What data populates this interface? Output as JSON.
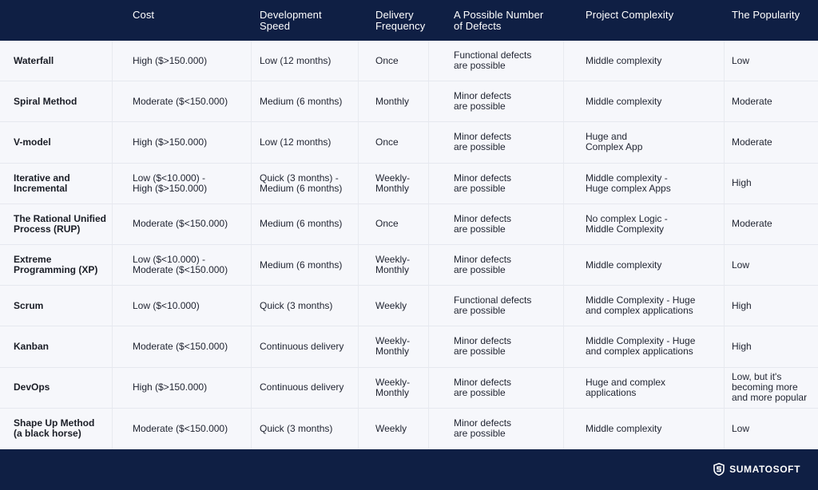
{
  "table": {
    "headers": [
      "",
      "Cost",
      "Development\nSpeed",
      "Delivery\nFrequency",
      "A Possible Number\nof Defects",
      "Project Complexity",
      "The Popularity"
    ],
    "rows": [
      [
        "Waterfall",
        "High ($>150.000)",
        "Low (12 months)",
        "Once",
        "Functional defects\nare possible",
        "Middle complexity",
        "Low"
      ],
      [
        "Spiral Method",
        "Moderate ($<150.000)",
        "Medium (6 months)",
        "Monthly",
        "Minor defects\nare possible",
        "Middle complexity",
        "Moderate"
      ],
      [
        "V-model",
        "High ($>150.000)",
        "Low (12 months)",
        "Once",
        "Minor defects\nare possible",
        "Huge and\nComplex App",
        "Moderate"
      ],
      [
        "Iterative and\nIncremental",
        "Low ($<10.000) -\nHigh ($>150.000)",
        "Quick (3 months) -\nMedium (6 months)",
        "Weekly-\nMonthly",
        "Minor defects\nare possible",
        "Middle complexity -\nHuge complex Apps",
        "High"
      ],
      [
        "The Rational Unified\nProcess (RUP)",
        "Moderate ($<150.000)",
        "Medium (6 months)",
        "Once",
        "Minor defects\nare possible",
        "No complex Logic -\nMiddle Complexity",
        "Moderate"
      ],
      [
        "Extreme\nProgramming (XP)",
        "Low ($<10.000) -\nModerate ($<150.000)",
        "Medium (6 months)",
        "Weekly-\nMonthly",
        "Minor defects\nare possible",
        "Middle complexity",
        "Low"
      ],
      [
        "Scrum",
        "Low ($<10.000)",
        "Quick (3 months)",
        "Weekly",
        "Functional defects\nare possible",
        "Middle Complexity - Huge\nand complex applications",
        "High"
      ],
      [
        "Kanban",
        "Moderate ($<150.000)",
        "Continuous delivery",
        "Weekly-\nMonthly",
        "Minor defects\nare possible",
        "Middle Complexity - Huge\nand complex applications",
        "High"
      ],
      [
        "DevOps",
        "High ($>150.000)",
        "Continuous delivery",
        "Weekly-\nMonthly",
        "Minor defects\nare possible",
        "Huge and complex\napplications",
        "Low, but it's\nbecoming more\nand more popular"
      ],
      [
        "Shape Up Method\n(a black horse)",
        "Moderate ($<150.000)",
        "Quick (3 months)",
        "Weekly",
        "Minor defects\nare possible",
        "Middle complexity",
        "Low"
      ]
    ]
  },
  "footer": {
    "brand": "SUMATOSOFT",
    "logo_icon": "shield-s-icon"
  },
  "colors": {
    "header_bg": "#0f1f44",
    "row_bg": "#f6f7fb",
    "header_text": "#ffffff",
    "body_text": "#1f2330"
  }
}
